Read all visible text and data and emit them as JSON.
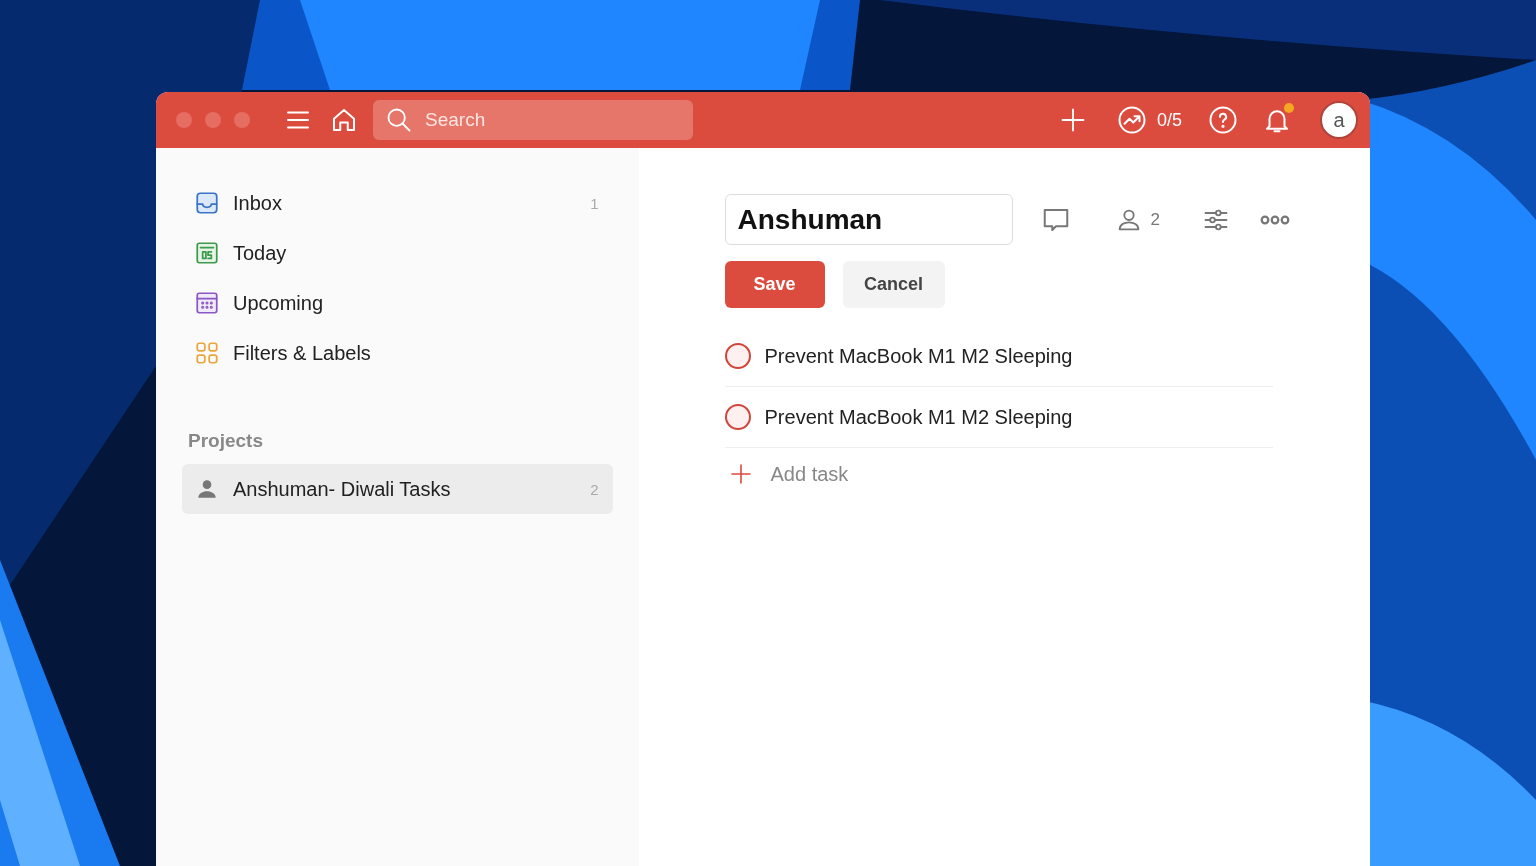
{
  "toolbar": {
    "search": {
      "placeholder": "Search"
    },
    "karma": "0/5",
    "avatar": "a",
    "notification": true
  },
  "sidebar": {
    "items": [
      {
        "kind": "inbox",
        "label": "Inbox",
        "count": "1"
      },
      {
        "kind": "today",
        "label": "Today"
      },
      {
        "kind": "upcoming",
        "label": "Upcoming"
      },
      {
        "kind": "filters",
        "label": "Filters & Labels"
      }
    ],
    "projects_heading": "Projects",
    "projects": [
      {
        "label": "Anshuman- Diwali Tasks",
        "count": "2",
        "selected": true
      }
    ]
  },
  "editor": {
    "name_value": "Anshuman",
    "collaborators": "2",
    "save": "Save",
    "cancel": "Cancel"
  },
  "tasks": [
    {
      "title": "Prevent MacBook M1 M2 Sleeping",
      "checked": false
    },
    {
      "title": "Prevent MacBook M1 M2 Sleeping",
      "checked": false
    }
  ],
  "add_task": "Add task"
}
